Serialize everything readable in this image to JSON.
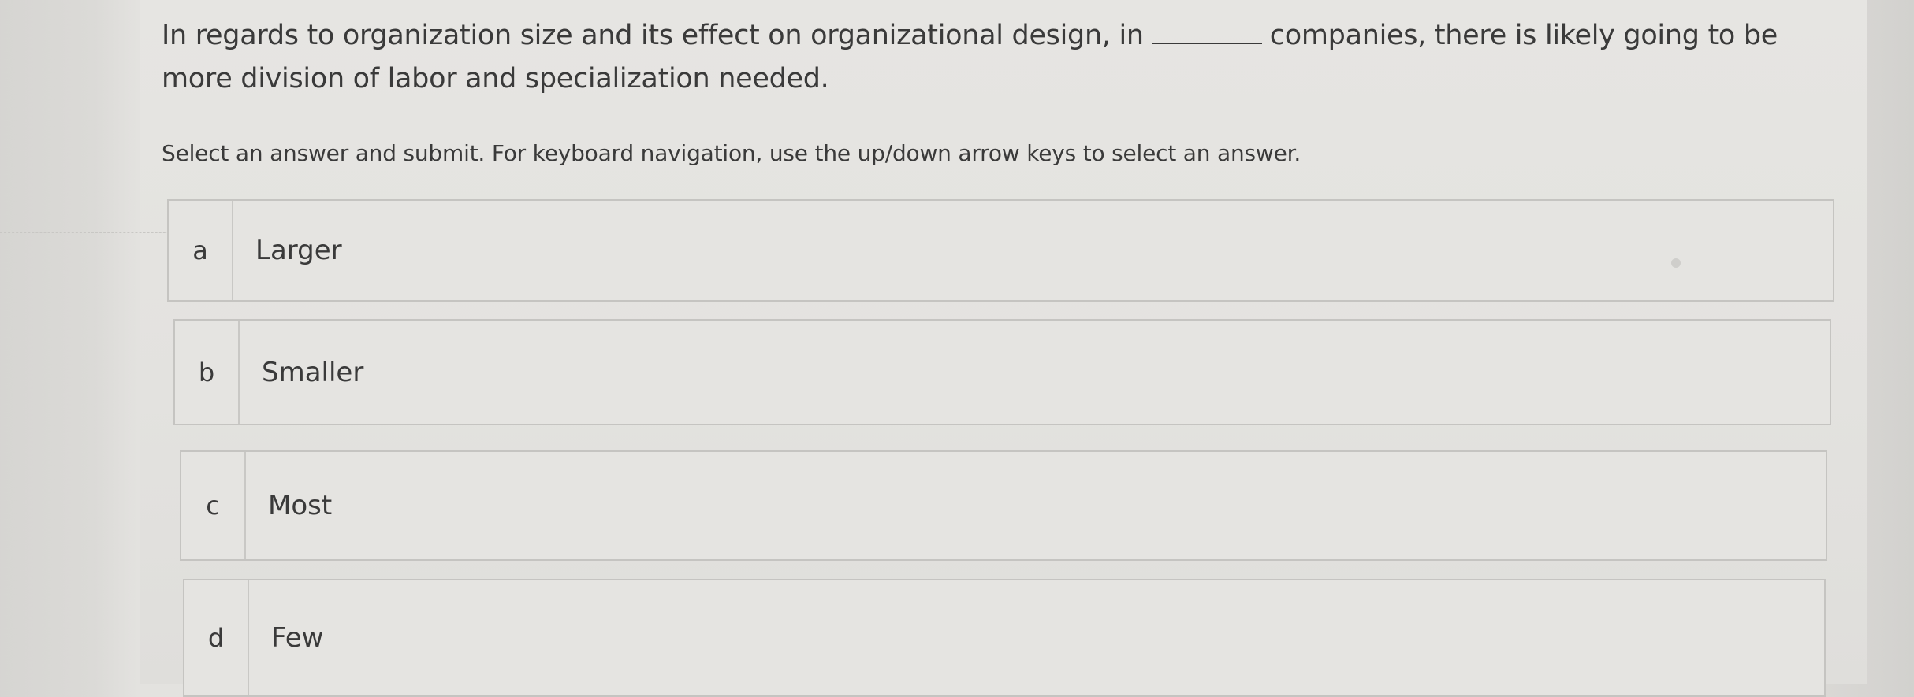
{
  "question": {
    "part1": "In regards to organization size and its effect on organizational design, in",
    "part2": "companies, there is likely going to be more division of labor and specialization needed."
  },
  "instructions": "Select an answer and submit. For keyboard navigation, use the up/down arrow keys to select an answer.",
  "options": [
    {
      "letter": "a",
      "label": "Larger"
    },
    {
      "letter": "b",
      "label": "Smaller"
    },
    {
      "letter": "c",
      "label": "Most"
    },
    {
      "letter": "d",
      "label": "Few"
    }
  ]
}
